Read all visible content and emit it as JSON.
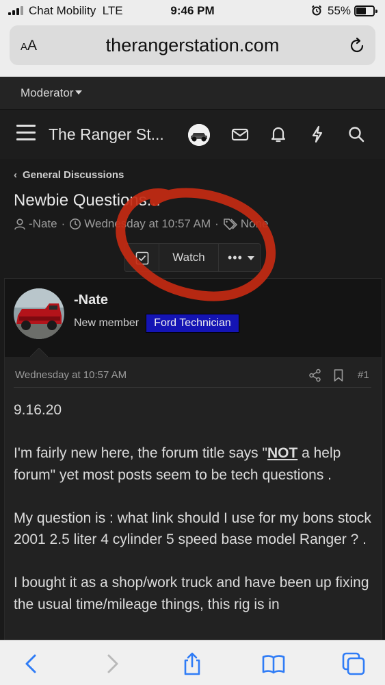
{
  "status_bar": {
    "carrier": "Chat Mobility",
    "network": "LTE",
    "time": "9:46 PM",
    "battery": "55%",
    "battery_level": 0.55
  },
  "url_bar": {
    "aa_label": "AA",
    "url": "therangerstation.com"
  },
  "moderator_menu": {
    "label": "Moderator"
  },
  "nav": {
    "site_title": "The Ranger St..."
  },
  "breadcrumb": {
    "label": "General Discussions"
  },
  "thread": {
    "title": "Newbie Questions...",
    "author": "-Nate",
    "date": "Wednesday at 10:57 AM",
    "tags": "None"
  },
  "watch_group": {
    "watch_label": "Watch",
    "more_label": "•••"
  },
  "post": {
    "author": "-Nate",
    "user_title": "New member",
    "banner": "Ford Technician",
    "date": "Wednesday at 10:57 AM",
    "number": "#1",
    "p1": "9.16.20",
    "p2_before": "I'm fairly new here, the forum title says \"",
    "p2_bold": "NOT",
    "p2_after": " a help forum\" yet most posts seem to be tech questions .",
    "p3": "My question is : what link should I use for my bons stock 2001 2.5 liter 4 cylinder 5 speed base model Ranger ? .",
    "p4": "I bought it as a shop/work truck and have been up fixing the usual time/mileage things, this rig is in"
  },
  "colors": {
    "page_bg": "#1a1a1a",
    "banner_bg": "#1414b4",
    "annotation_red": "#c42a12"
  }
}
